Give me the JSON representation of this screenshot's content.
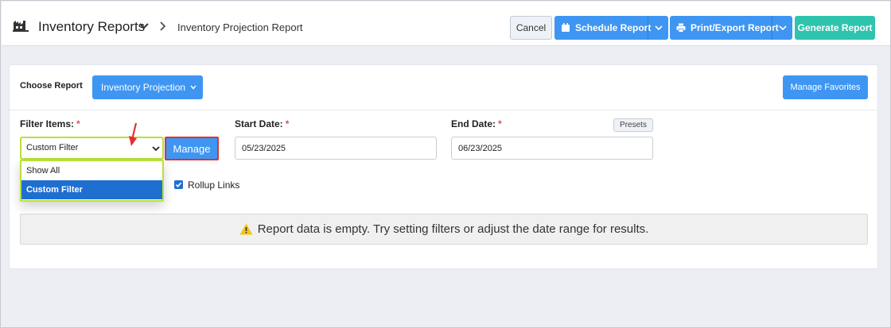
{
  "header": {
    "app_title": "Inventory Reports",
    "breadcrumb": "Inventory Projection Report",
    "buttons": {
      "cancel": "Cancel",
      "schedule": "Schedule Report",
      "print_export": "Print/Export Report",
      "generate": "Generate Report"
    }
  },
  "report_chooser": {
    "label": "Choose Report",
    "selected": "Inventory Projection",
    "manage_favorites": "Manage Favorites"
  },
  "filters": {
    "filter_items": {
      "label": "Filter Items:",
      "required_mark": "*",
      "value": "Custom Filter",
      "manage_label": "Manage",
      "options": [
        "Show All",
        "Custom Filter"
      ],
      "selected_option": "Custom Filter"
    },
    "start_date": {
      "label": "Start Date:",
      "required_mark": "*",
      "value": "05/23/2025"
    },
    "end_date": {
      "label": "End Date:",
      "required_mark": "*",
      "value": "06/23/2025"
    },
    "presets_label": "Presets",
    "rollup_links": {
      "label": "Rollup Links",
      "checked": true
    }
  },
  "message": {
    "text": "Report data is empty. Try setting filters or adjust the date range for results."
  },
  "colors": {
    "primary": "#3e96f2",
    "success": "#2ec4ae",
    "highlight_green": "#b6e13a",
    "highlight_red": "#e2302d",
    "selected_option": "#1f6fd1",
    "warning": "#f5c518"
  }
}
